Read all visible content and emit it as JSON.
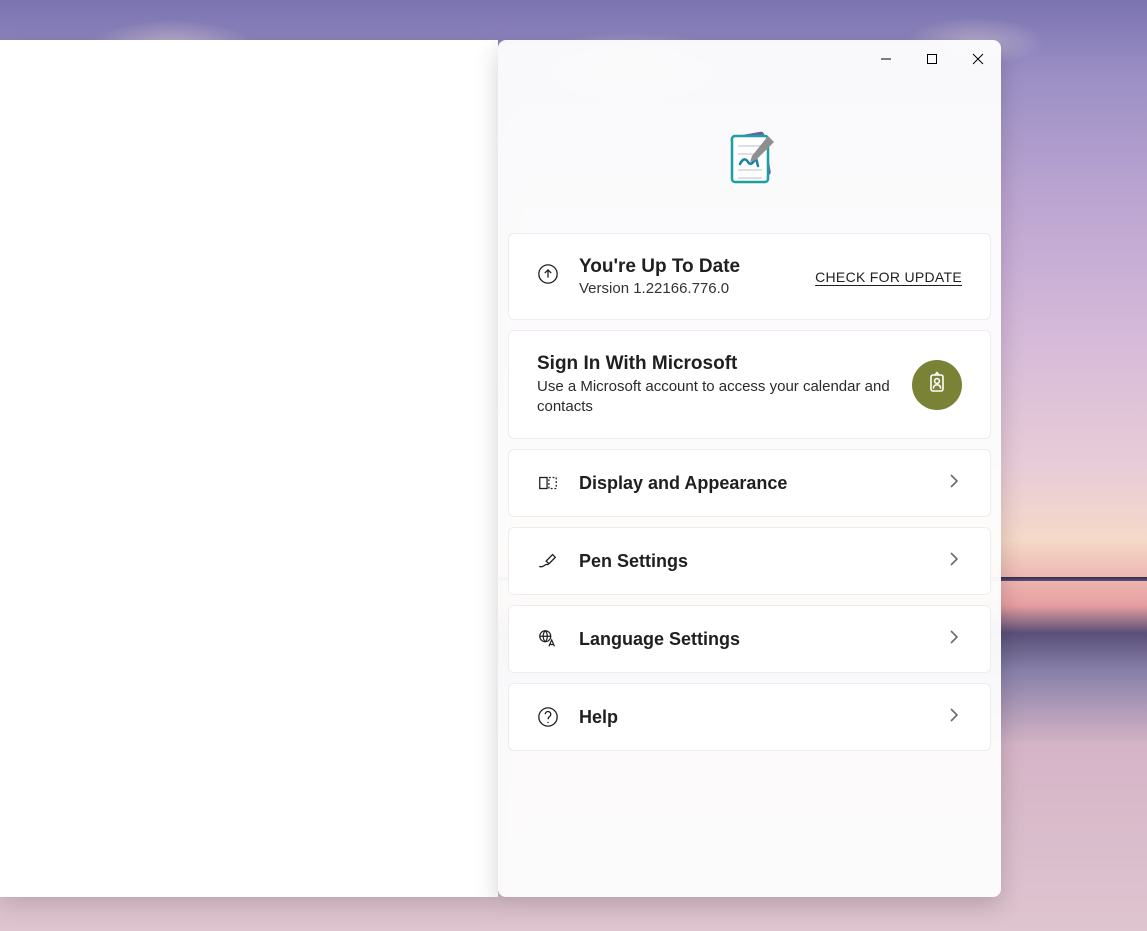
{
  "update": {
    "title": "You're Up To Date",
    "version": "Version  1.22166.776.0",
    "check_label": "CHECK FOR UPDATE"
  },
  "signin": {
    "title": "Sign In With Microsoft",
    "desc": "Use a Microsoft account to access your calendar and contacts"
  },
  "nav": {
    "display": "Display and Appearance",
    "pen": "Pen Settings",
    "language": "Language Settings",
    "help": "Help"
  }
}
